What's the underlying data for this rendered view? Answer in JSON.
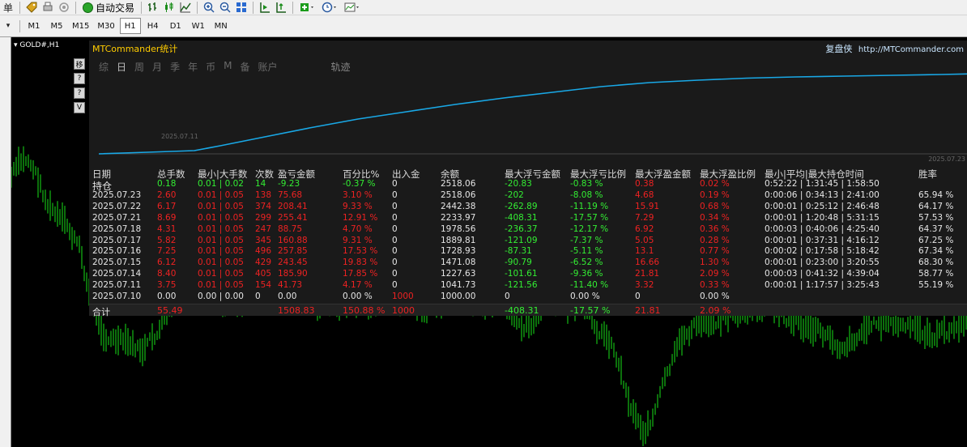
{
  "toolbar": {
    "menu_fragment": "单",
    "autotrade_label": "自动交易"
  },
  "timeframes": [
    "M1",
    "M5",
    "M15",
    "M30",
    "H1",
    "H4",
    "D1",
    "W1",
    "MN"
  ],
  "active_timeframe": "H1",
  "chart": {
    "symbol": "GOLD#,H1"
  },
  "panel": {
    "title": "MTCommander统计",
    "brand": "复盘侠",
    "site": "http://MTCommander.com",
    "tabs": [
      "综",
      "日",
      "周",
      "月",
      "季",
      "年",
      "币",
      "M",
      "备",
      "账户"
    ],
    "active_tab": "日",
    "track_tab": "轨迹",
    "curve_start_date": "2025.07.11",
    "curve_end_date": "2025.07.23",
    "side_buttons": [
      "移",
      "?",
      "?",
      "V"
    ],
    "headers": {
      "date": "日期",
      "lots": "总手数",
      "minmax": "最小|大手数",
      "count": "次数",
      "pl": "盈亏金额",
      "pct": "百分比%",
      "io": "出入金",
      "balance": "余额",
      "max_float_loss": "最大浮亏金额",
      "max_float_loss_pct": "最大浮亏比例",
      "max_float_profit": "最大浮盈金额",
      "max_float_profit_pct": "最大浮盈比例",
      "hold_time": "最小|平均|最大持仓时间",
      "winrate": "胜率"
    },
    "rows": [
      {
        "date": "持仓",
        "lots": "0.18",
        "minmax": "0.01 | 0.02",
        "count": "14",
        "pl": "-9.23",
        "pct": "-0.37 %",
        "io": "0",
        "balance": "2518.06",
        "mfl": "-20.83",
        "mflp": "-0.83 %",
        "mfp": "0.38",
        "mfpp": "0.02 %",
        "time": "0:52:22 | 1:31:45 | 1:58:50",
        "win": "",
        "style": "open"
      },
      {
        "date": "2025.07.23",
        "lots": "2.60",
        "minmax": "0.01 | 0.05",
        "count": "138",
        "pl": "75.68",
        "pct": "3.10 %",
        "io": "0",
        "balance": "2518.06",
        "mfl": "-202",
        "mflp": "-8.08 %",
        "mfp": "4.68",
        "mfpp": "0.19 %",
        "time": "0:00:06 | 0:34:13 | 2:41:00",
        "win": "65.94 %",
        "style": "day"
      },
      {
        "date": "2025.07.22",
        "lots": "6.17",
        "minmax": "0.01 | 0.05",
        "count": "374",
        "pl": "208.41",
        "pct": "9.33 %",
        "io": "0",
        "balance": "2442.38",
        "mfl": "-262.89",
        "mflp": "-11.19 %",
        "mfp": "15.91",
        "mfpp": "0.68 %",
        "time": "0:00:01 | 0:25:12 | 2:46:48",
        "win": "64.17 %",
        "style": "day"
      },
      {
        "date": "2025.07.21",
        "lots": "8.69",
        "minmax": "0.01 | 0.05",
        "count": "299",
        "pl": "255.41",
        "pct": "12.91 %",
        "io": "0",
        "balance": "2233.97",
        "mfl": "-408.31",
        "mflp": "-17.57 %",
        "mfp": "7.29",
        "mfpp": "0.34 %",
        "time": "0:00:01 | 1:20:48 | 5:31:15",
        "win": "57.53 %",
        "style": "day"
      },
      {
        "date": "2025.07.18",
        "lots": "4.31",
        "minmax": "0.01 | 0.05",
        "count": "247",
        "pl": "88.75",
        "pct": "4.70 %",
        "io": "0",
        "balance": "1978.56",
        "mfl": "-236.37",
        "mflp": "-12.17 %",
        "mfp": "6.92",
        "mfpp": "0.36 %",
        "time": "0:00:03 | 0:40:06 | 4:25:40",
        "win": "64.37 %",
        "style": "day"
      },
      {
        "date": "2025.07.17",
        "lots": "5.82",
        "minmax": "0.01 | 0.05",
        "count": "345",
        "pl": "160.88",
        "pct": "9.31 %",
        "io": "0",
        "balance": "1889.81",
        "mfl": "-121.09",
        "mflp": "-7.37 %",
        "mfp": "5.05",
        "mfpp": "0.28 %",
        "time": "0:00:01 | 0:37:31 | 4:16:12",
        "win": "67.25 %",
        "style": "day"
      },
      {
        "date": "2025.07.16",
        "lots": "7.25",
        "minmax": "0.01 | 0.05",
        "count": "496",
        "pl": "257.85",
        "pct": "17.53 %",
        "io": "0",
        "balance": "1728.93",
        "mfl": "-87.31",
        "mflp": "-5.11 %",
        "mfp": "13.1",
        "mfpp": "0.77 %",
        "time": "0:00:02 | 0:17:58 | 5:18:42",
        "win": "67.34 %",
        "style": "day"
      },
      {
        "date": "2025.07.15",
        "lots": "6.12",
        "minmax": "0.01 | 0.05",
        "count": "429",
        "pl": "243.45",
        "pct": "19.83 %",
        "io": "0",
        "balance": "1471.08",
        "mfl": "-90.79",
        "mflp": "-6.52 %",
        "mfp": "16.66",
        "mfpp": "1.30 %",
        "time": "0:00:01 | 0:23:00 | 3:20:55",
        "win": "68.30 %",
        "style": "day"
      },
      {
        "date": "2025.07.14",
        "lots": "8.40",
        "minmax": "0.01 | 0.05",
        "count": "405",
        "pl": "185.90",
        "pct": "17.85 %",
        "io": "0",
        "balance": "1227.63",
        "mfl": "-101.61",
        "mflp": "-9.36 %",
        "mfp": "21.81",
        "mfpp": "2.09 %",
        "time": "0:00:03 | 0:41:32 | 4:39:04",
        "win": "58.77 %",
        "style": "day"
      },
      {
        "date": "2025.07.11",
        "lots": "3.75",
        "minmax": "0.01 | 0.05",
        "count": "154",
        "pl": "41.73",
        "pct": "4.17 %",
        "io": "0",
        "balance": "1041.73",
        "mfl": "-121.56",
        "mflp": "-11.40 %",
        "mfp": "3.32",
        "mfpp": "0.33 %",
        "time": "0:00:01 | 1:17:57 | 3:25:43",
        "win": "55.19 %",
        "style": "day"
      },
      {
        "date": "2025.07.10",
        "lots": "0.00",
        "minmax": "0.00 | 0.00",
        "count": "0",
        "pl": "0.00",
        "pct": "0.00 %",
        "io": "1000",
        "balance": "1000.00",
        "mfl": "0",
        "mflp": "0.00 %",
        "mfp": "0",
        "mfpp": "0.00 %",
        "time": "",
        "win": "",
        "style": "deposit"
      }
    ],
    "total": {
      "label": "合计",
      "lots": "55.49",
      "pl": "1508.83",
      "pct": "150.88 %",
      "io": "1000",
      "mfl": "-408.31",
      "mflp": "-17.57 %",
      "mfp": "21.81",
      "mfpp": "2.09 %"
    }
  }
}
